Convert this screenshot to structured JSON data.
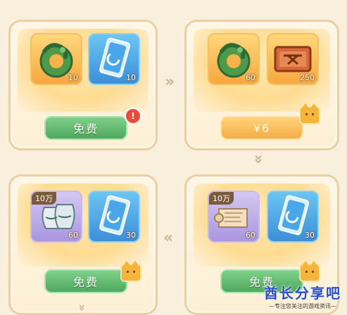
{
  "cards": [
    {
      "items": [
        {
          "icon": "jade-dragon-icon",
          "count": "10"
        },
        {
          "icon": "fate-card-icon",
          "count": "10"
        }
      ],
      "button_label": "免费",
      "has_alert": true,
      "alert_text": "!"
    },
    {
      "items": [
        {
          "icon": "jade-dragon-icon",
          "count": "60"
        },
        {
          "icon": "bronze-tablet-icon",
          "count": "250"
        }
      ],
      "button_label": "¥6"
    },
    {
      "items": [
        {
          "icon": "porcelain-vase-icon",
          "count": "60",
          "tag": "10万"
        },
        {
          "icon": "fate-card-icon",
          "count": "30"
        }
      ],
      "button_label": "免费"
    },
    {
      "items": [
        {
          "icon": "scroll-icon",
          "count": "60",
          "tag": "10万"
        },
        {
          "icon": "fate-card-icon",
          "count": "30"
        }
      ],
      "button_label": "免费"
    }
  ],
  "watermark": {
    "title": "酋长分享吧",
    "subtitle": "—专注您关注的游戏资讯—"
  }
}
